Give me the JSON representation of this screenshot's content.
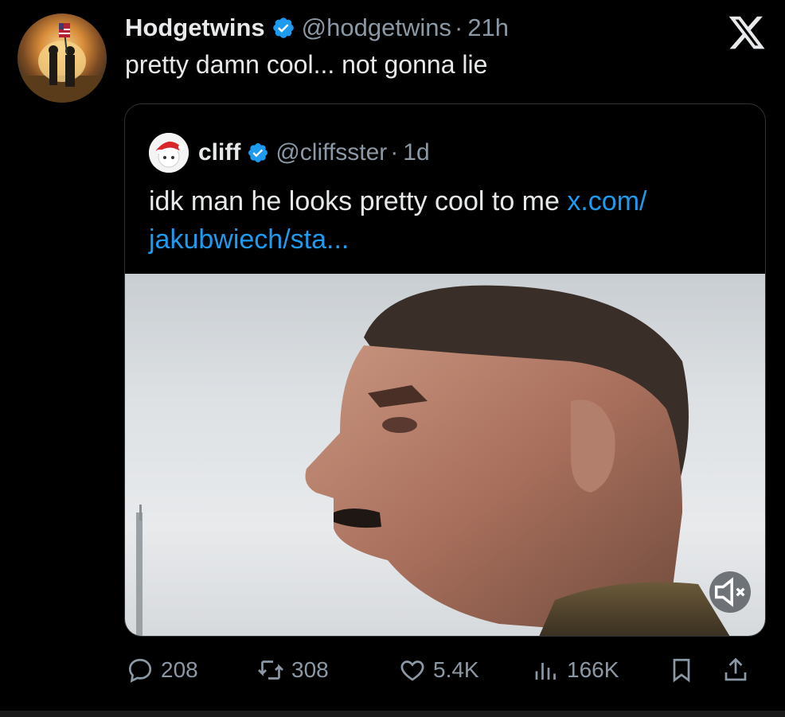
{
  "tweet": {
    "author": {
      "display_name": "Hodgetwins",
      "handle": "@hodgetwins",
      "time": "21h",
      "separator": "·",
      "avatar_icon": "avatar-photo"
    },
    "text": "pretty damn cool... not gonna lie",
    "platform_icon": "x-logo-icon"
  },
  "quote": {
    "author": {
      "display_name": "cliff",
      "handle": "@cliffsster",
      "time": "1d",
      "separator": "·"
    },
    "text_prefix": "idk man he looks pretty cool to me ",
    "link_line1": "x.com/",
    "link_line2": "jakubwiech/sta..."
  },
  "actions": {
    "replies": "208",
    "retweets": "308",
    "likes": "5.4K",
    "views": "166K"
  },
  "colors": {
    "background": "#000000",
    "text": "#e7e9ea",
    "muted": "#8b98a5",
    "link": "#1d9bf0",
    "verified": "#1d9bf0",
    "border": "#2f3336"
  }
}
